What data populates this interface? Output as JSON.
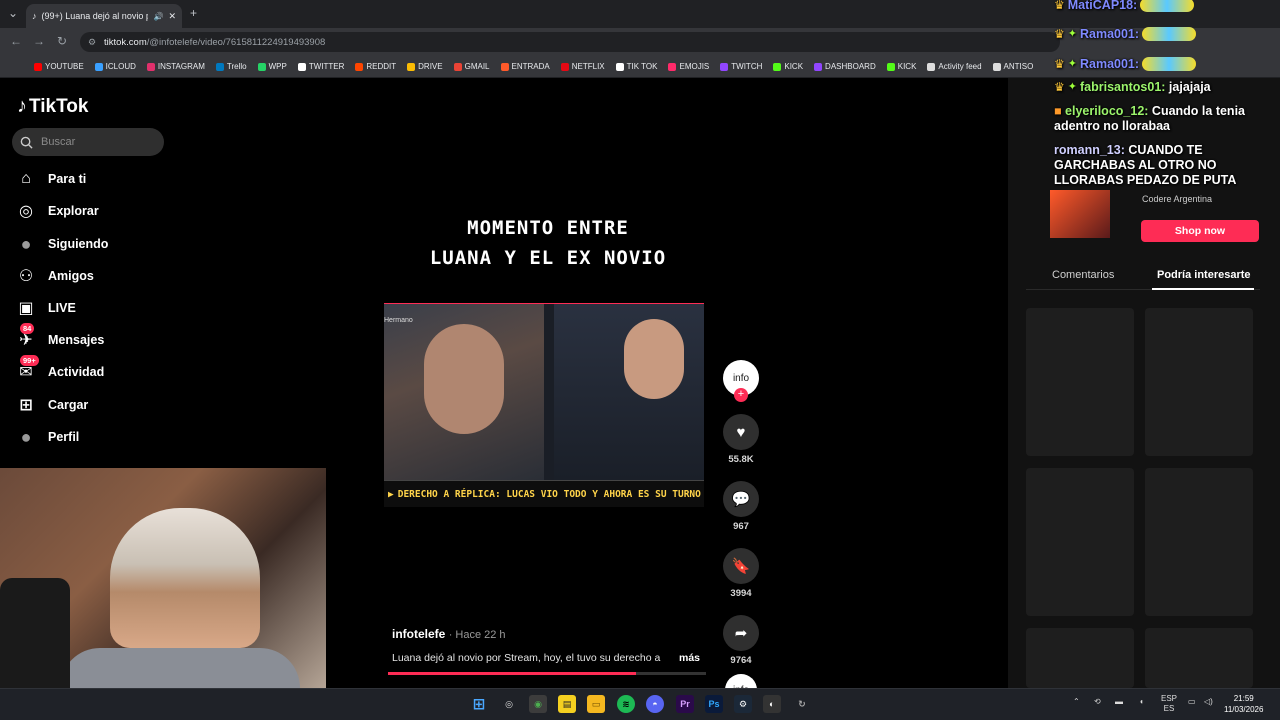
{
  "browser": {
    "tab_title": "(99+) Luana dejó al novio p",
    "new_tab_symbol": "+",
    "url_host": "tiktok.com",
    "url_path": "/@infotelefe/video/7615811224919493908",
    "bookmarks": [
      {
        "label": "YOUTUBE",
        "color": "#ff0000"
      },
      {
        "label": "ICLOUD",
        "color": "#3aa0ff"
      },
      {
        "label": "INSTAGRAM",
        "color": "#e1306c"
      },
      {
        "label": "Trello",
        "color": "#0079bf"
      },
      {
        "label": "WPP",
        "color": "#25d366"
      },
      {
        "label": "TWITTER",
        "color": "#ffffff"
      },
      {
        "label": "REDDIT",
        "color": "#ff4500"
      },
      {
        "label": "DRIVE",
        "color": "#fbbc04"
      },
      {
        "label": "GMAIL",
        "color": "#ea4335"
      },
      {
        "label": "ENTRADA",
        "color": "#ff5a2a"
      },
      {
        "label": "NETFLIX",
        "color": "#e50914"
      },
      {
        "label": "TIK TOK",
        "color": "#ffffff"
      },
      {
        "label": "EMOJIS",
        "color": "#ff2a6a"
      },
      {
        "label": "TWITCH",
        "color": "#9146ff"
      },
      {
        "label": "KICK",
        "color": "#53fc18"
      },
      {
        "label": "DASHBOARD",
        "color": "#9146ff"
      },
      {
        "label": "KICK",
        "color": "#53fc18"
      },
      {
        "label": "Activity feed",
        "color": "#dddddd"
      },
      {
        "label": "ANTISO",
        "color": "#dddddd"
      }
    ]
  },
  "tiktok": {
    "logo": "TikTok",
    "search_placeholder": "Buscar",
    "menu": [
      {
        "label": "Para ti",
        "icon": "home-icon"
      },
      {
        "label": "Explorar",
        "icon": "compass-icon"
      },
      {
        "label": "Siguiendo",
        "icon": "following-avatar-icon"
      },
      {
        "label": "Amigos",
        "icon": "friends-icon"
      },
      {
        "label": "LIVE",
        "icon": "live-icon"
      },
      {
        "label": "Mensajes",
        "icon": "messages-icon",
        "badge": "84"
      },
      {
        "label": "Actividad",
        "icon": "activity-icon",
        "badge": "99+"
      },
      {
        "label": "Cargar",
        "icon": "upload-icon"
      },
      {
        "label": "Perfil",
        "icon": "profile-avatar-icon"
      }
    ],
    "video": {
      "headline_line1": "MOMENTO ENTRE",
      "headline_line2": "LUANA Y EL EX NOVIO",
      "frame_tag": "Hermano",
      "ticker": "DERECHO A RÉPLICA: LUCAS VIO TODO Y AHORA ES SU TURNO DE HA",
      "author": "infotelefe",
      "posted": "· Hace 22 h",
      "description": "Luana dejó al novio por Stream, hoy, el tuvo su derecho a",
      "more": "más",
      "progress": 0.78
    },
    "actions": {
      "avatar_text": "info",
      "likes": "55.8K",
      "comments": "967",
      "saves": "3994",
      "shares": "9764"
    },
    "right_panel": {
      "ad_brand": "Codere Argentina",
      "shop_now": "Shop now",
      "tabs": [
        "Comentarios",
        "Podría interesarte"
      ]
    }
  },
  "chat_overlay": [
    {
      "user": "MatiCAP18:",
      "msg": "",
      "emote": true
    },
    {
      "user": "Rama001:",
      "msg": "",
      "emote": true
    },
    {
      "user": "Rama001:",
      "msg": "",
      "emote": true
    },
    {
      "user": "fabrisantos01:",
      "msg": "jajajaja"
    },
    {
      "user": "elyeriloco_12:",
      "msg": "Cuando la tenia adentro no llorabaa"
    },
    {
      "user": "romann_13:",
      "msg": "CUANDO TE GARCHABAS AL OTRO NO LLORABAS PEDAZO DE PUTA"
    }
  ],
  "taskbar": {
    "lang_top": "ESP",
    "lang_bottom": "ES",
    "time": "21:59",
    "date": "11/03/2026"
  }
}
